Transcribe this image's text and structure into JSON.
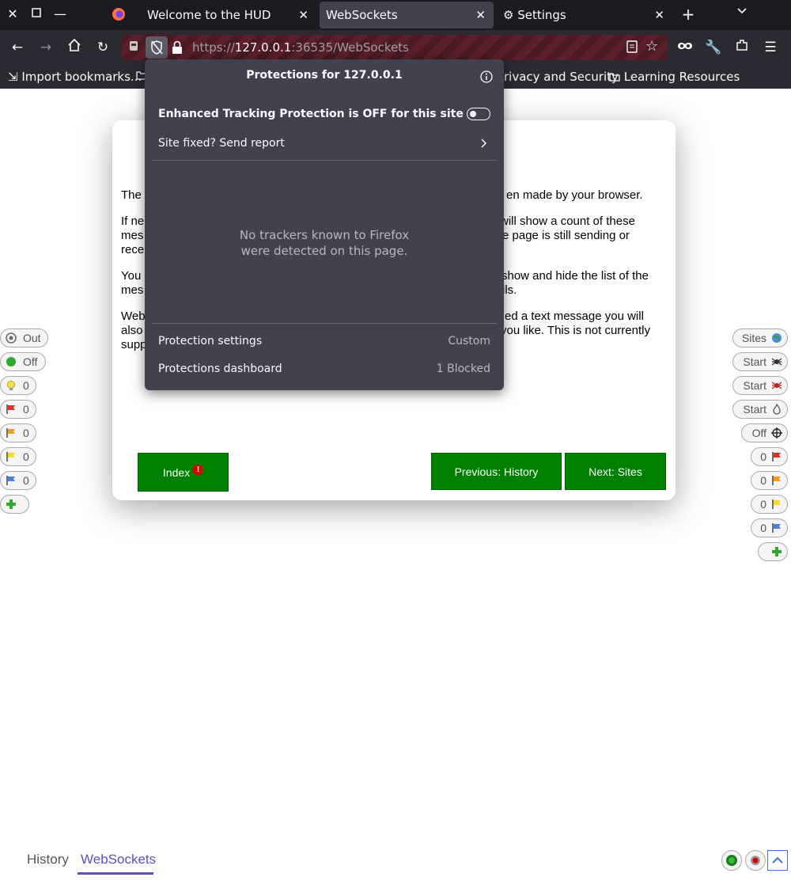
{
  "tabbar": {
    "tabs": [
      {
        "label": "Welcome to the HUD",
        "close": "✕"
      },
      {
        "label": "WebSockets",
        "close": "✕"
      },
      {
        "label": "Settings",
        "close": "✕"
      }
    ],
    "new_tab": "+",
    "list_all": "⌄"
  },
  "navbar": {
    "url_scheme": "https://",
    "url_host": "127.0.0.1",
    "url_rest": ":36535/WebSockets"
  },
  "bookmarks": {
    "items": [
      {
        "label": "Import bookmarks..."
      },
      {
        "label": "rivacy and Security"
      },
      {
        "label": "Learning Resources"
      }
    ]
  },
  "page": {
    "paragraphs": [
      {
        "left": "The",
        "right": "en made by your browser."
      },
      {
        "left": [
          "If ne",
          "mes",
          "rece"
        ],
        "right": [
          "will show a count of these",
          "e page is still sending or",
          ""
        ]
      },
      {
        "left": [
          "You",
          "mes"
        ],
        "right": [
          "show and hide the list of the",
          "ils."
        ]
      },
      {
        "left": [
          "Web",
          "also",
          "supp"
        ],
        "right": [
          "ed a text message you will",
          "you like. This is not currently",
          ""
        ]
      }
    ],
    "buttons": {
      "index": "Index",
      "previous": "Previous: History",
      "next": "Next: Sites"
    }
  },
  "hud_left": [
    {
      "label": "Out",
      "icon": "target-icon"
    },
    {
      "label": "Off",
      "icon": "green-dot-icon"
    },
    {
      "label": "0",
      "icon": "bulb-icon"
    },
    {
      "label": "0",
      "icon": "red-flag-icon"
    },
    {
      "label": "0",
      "icon": "orange-flag-icon"
    },
    {
      "label": "0",
      "icon": "yellow-flag-icon"
    },
    {
      "label": "0",
      "icon": "blue-flag-icon"
    }
  ],
  "hud_right": [
    {
      "label": "Sites",
      "icon": "globe-icon"
    },
    {
      "label": "Start",
      "icon": "spider-icon"
    },
    {
      "label": "Start",
      "icon": "ajax-spider-icon"
    },
    {
      "label": "Start",
      "icon": "flame-icon"
    },
    {
      "label": "Off",
      "icon": "crosshair-icon"
    },
    {
      "label": "0",
      "icon": "red-flag-icon"
    },
    {
      "label": "0",
      "icon": "orange-flag-icon"
    },
    {
      "label": "0",
      "icon": "yellow-flag-icon"
    },
    {
      "label": "0",
      "icon": "blue-flag-icon"
    }
  ],
  "bottom_tabs": [
    {
      "label": "History"
    },
    {
      "label": "WebSockets"
    }
  ],
  "popup": {
    "title": "Protections for 127.0.0.1",
    "etp_status": "Enhanced Tracking Protection is OFF for this site",
    "report": "Site fixed? Send report",
    "no_trackers_line1": "No trackers known to Firefox",
    "no_trackers_line2": "were detected on this page.",
    "settings_label": "Protection settings",
    "settings_value": "Custom",
    "dashboard_label": "Protections dashboard",
    "dashboard_value": "1 Blocked"
  },
  "colors": {
    "accent_green": "#008000",
    "active_tab": "#5b4fc4"
  }
}
